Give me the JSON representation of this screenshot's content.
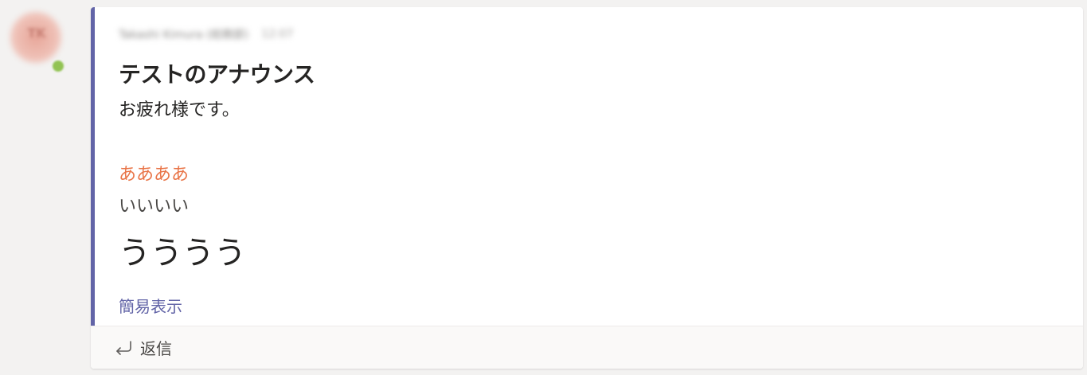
{
  "avatar": {
    "initials": "TK",
    "presence_color": "#92c353"
  },
  "message": {
    "sender": "Takashi Kimura (総務部)",
    "timestamp": "12:07",
    "subject": "テストのアナウンス",
    "greeting": "お疲れ様です。",
    "line_red": "ああああ",
    "line_normal": "いいいい",
    "line_large": "うううう",
    "collapse_label": "簡易表示"
  },
  "footer": {
    "reply_label": "返信",
    "reply_icon": "reply-arrow-icon"
  },
  "colors": {
    "accent": "#6264a7",
    "highlight_text": "#e97548",
    "background": "#f3f2f1"
  }
}
